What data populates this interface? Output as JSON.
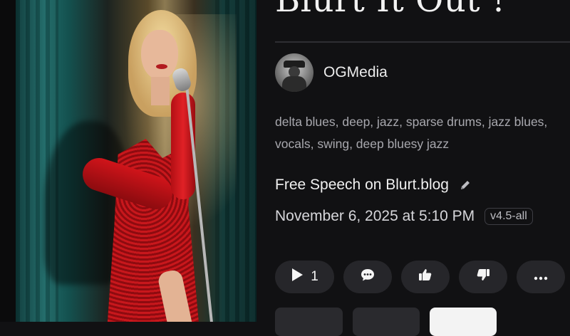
{
  "song": {
    "title": "Blurt It Out !",
    "author": "OGMedia",
    "tags_line1": "delta blues, deep, jazz, sparse drums, jazz blues,",
    "tags_line2": "vocals, swing, deep bluesy jazz",
    "workspace": "Free Speech on Blurt.blog",
    "date": "November 6, 2025 at 5:10 PM",
    "version": "v4.5-all"
  },
  "actions": {
    "play_count": "1",
    "icons": [
      "play-icon",
      "comment-icon",
      "thumbs-up-icon",
      "thumbs-down-icon",
      "more-icon"
    ]
  },
  "colors": {
    "background": "#111113",
    "pill": "#26262a",
    "text": "#f0f0f0",
    "muted": "#a8a8ae"
  }
}
